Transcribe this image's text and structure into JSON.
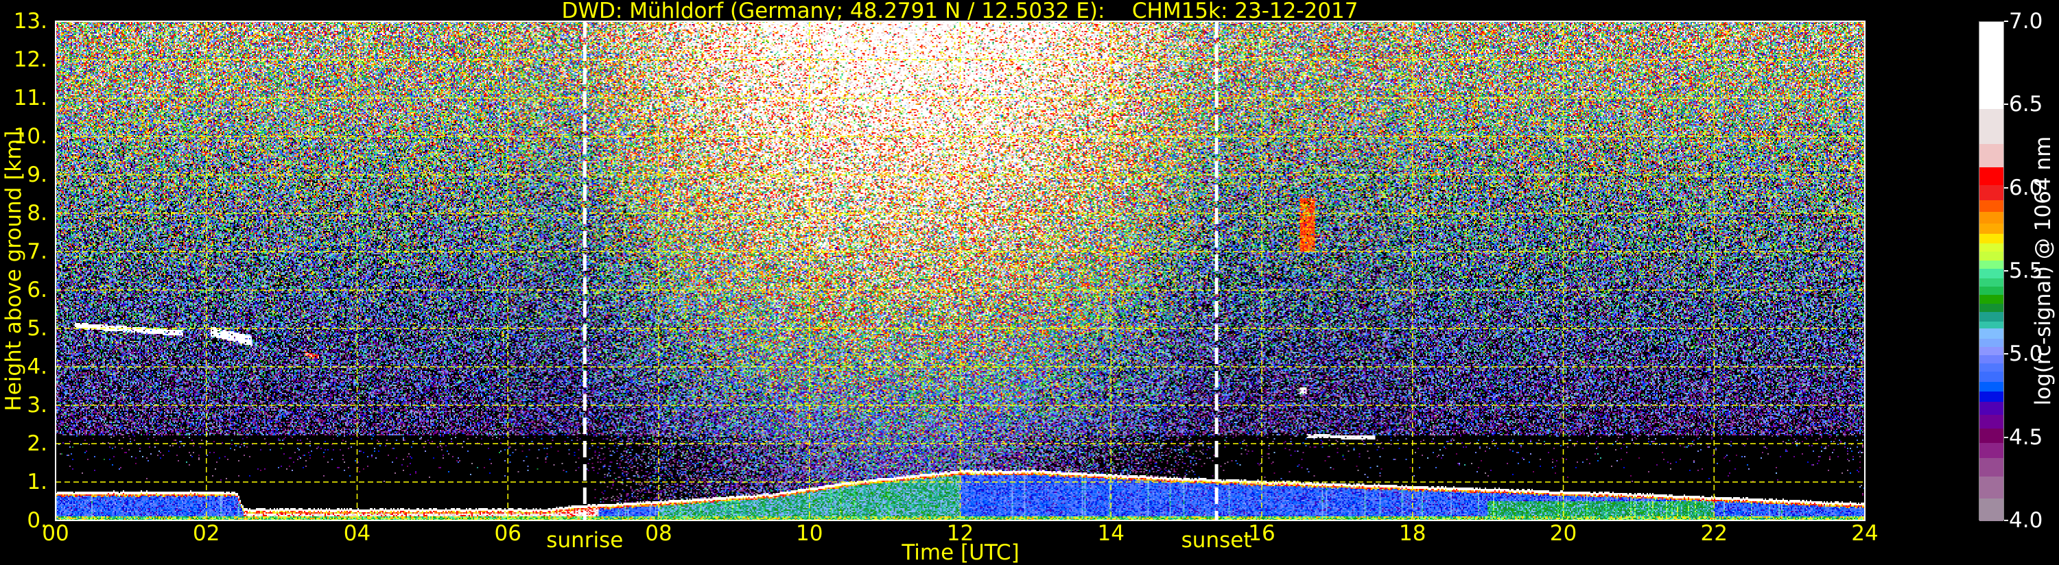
{
  "chart_data": {
    "type": "heatmap",
    "title": "DWD: Mühldorf (Germany; 48.2791 N / 12.5032 E):    CHM15k: 23-12-2017",
    "xlabel": "Time [UTC]",
    "ylabel": "Height above ground [km]",
    "xlim": [
      0,
      24
    ],
    "ylim": [
      0,
      13
    ],
    "xticks": [
      "00",
      "02",
      "04",
      "06",
      "08",
      "10",
      "12",
      "14",
      "16",
      "18",
      "20",
      "22",
      "24"
    ],
    "yticks": [
      "0.",
      "1.",
      "2.",
      "3.",
      "4.",
      "5.",
      "6.",
      "7.",
      "8.",
      "9.",
      "10.",
      "11.",
      "12.",
      "13."
    ],
    "grid": true,
    "annotations": [
      {
        "label": "sunrise",
        "time": 7.02
      },
      {
        "label": "sunset",
        "time": 15.4
      }
    ],
    "colorbar": {
      "label": "log(rc-signal) @ 1064 nm",
      "range": [
        4.0,
        7.0
      ],
      "ticks": [
        "4.0",
        "4.5",
        "5.0",
        "5.5",
        "6.0",
        "6.5",
        "7.0"
      ],
      "bands": [
        [
          4.0,
          "#a08ca0"
        ],
        [
          4.14,
          "#a06e9b"
        ],
        [
          4.27,
          "#964b91"
        ],
        [
          4.38,
          "#8c2387"
        ],
        [
          4.47,
          "#780064"
        ],
        [
          4.56,
          "#6e0096"
        ],
        [
          4.64,
          "#5000b4"
        ],
        [
          4.72,
          "#0010e6"
        ],
        [
          4.78,
          "#0060ff"
        ],
        [
          4.84,
          "#3c6eff"
        ],
        [
          4.9,
          "#5078ff"
        ],
        [
          4.95,
          "#6e82ff"
        ],
        [
          5.0,
          "#8c96ff"
        ],
        [
          5.05,
          "#7daaff"
        ],
        [
          5.1,
          "#82beff"
        ],
        [
          5.16,
          "#32c3aa"
        ],
        [
          5.2,
          "#1ea08c"
        ],
        [
          5.26,
          "#149132"
        ],
        [
          5.31,
          "#1ea500"
        ],
        [
          5.36,
          "#1ebe50"
        ],
        [
          5.41,
          "#32d278"
        ],
        [
          5.46,
          "#46e6a0"
        ],
        [
          5.52,
          "#82ff82"
        ],
        [
          5.57,
          "#c8ff3c"
        ],
        [
          5.62,
          "#dcff32"
        ],
        [
          5.67,
          "#ffe600"
        ],
        [
          5.73,
          "#ffaa00"
        ],
        [
          5.79,
          "#ff9600"
        ],
        [
          5.86,
          "#ff5a00"
        ],
        [
          5.93,
          "#f02020"
        ],
        [
          6.02,
          "#ff0000"
        ],
        [
          6.13,
          "#f0c4c4"
        ],
        [
          6.27,
          "#ebe1e1"
        ],
        [
          6.48,
          "#ffffff"
        ]
      ]
    },
    "boundary_layer_top_km": {
      "time": [
        0,
        2.4,
        2.5,
        4.0,
        6.5,
        7.0,
        8.0,
        9.5,
        10.5,
        12.0,
        13.0,
        15.0,
        18.0,
        21.0,
        24.0
      ],
      "height": [
        0.75,
        0.75,
        0.3,
        0.3,
        0.3,
        0.4,
        0.5,
        0.7,
        1.0,
        1.3,
        1.3,
        1.1,
        0.9,
        0.7,
        0.45
      ]
    },
    "cloud_layers": [
      {
        "t_start": 0.25,
        "t_end": 1.7,
        "base_km_start": 5.0,
        "base_km_end": 4.8,
        "thickness_km": 0.15,
        "log_signal": 6.8
      },
      {
        "t_start": 2.05,
        "t_end": 2.6,
        "base_km_start": 4.8,
        "base_km_end": 4.55,
        "thickness_km": 0.25,
        "log_signal": 6.8
      },
      {
        "t_start": 3.3,
        "t_end": 3.5,
        "base_km_start": 4.3,
        "base_km_end": 4.2,
        "thickness_km": 0.1,
        "log_signal": 6.1
      },
      {
        "t_start": 16.5,
        "t_end": 16.7,
        "base_km_start": 7.0,
        "base_km_end": 7.0,
        "thickness_km": 1.4,
        "log_signal": 5.9
      },
      {
        "t_start": 16.5,
        "t_end": 16.6,
        "base_km_start": 3.3,
        "base_km_end": 3.3,
        "thickness_km": 0.15,
        "log_signal": 6.6
      },
      {
        "t_start": 16.6,
        "t_end": 17.5,
        "base_km_start": 2.15,
        "base_km_end": 2.1,
        "thickness_km": 0.1,
        "log_signal": 6.6
      }
    ]
  }
}
